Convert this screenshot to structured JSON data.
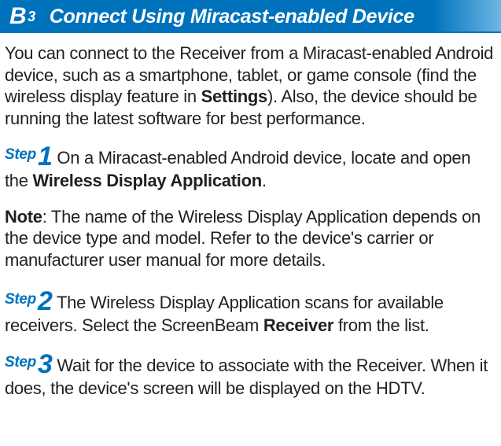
{
  "header": {
    "badge_letter": "B",
    "badge_super": "3",
    "title": "Connect Using Miracast-enabled Device"
  },
  "intro": {
    "pre": "You can connect to the Receiver from a Miracast-enabled Android device, such as a smartphone, tablet, or game console (find the wireless display feature in ",
    "bold": "Settings",
    "post": "). Also, the device should be running the latest software for best performance."
  },
  "steps": [
    {
      "label_word": "Step",
      "label_num": "1",
      "pre": " On a Miracast-enabled Android device, locate and open the ",
      "bold": "Wireless Display Application",
      "post": "."
    },
    {
      "label_word": "Step",
      "label_num": "2",
      "pre": " The Wireless Display Application scans for available receivers. Select the ScreenBeam ",
      "bold": "Receiver",
      "post": " from the list."
    },
    {
      "label_word": "Step",
      "label_num": "3",
      "pre": " Wait for the device to associate with the Receiver. When it does, the device's screen will be displayed on the HDTV.",
      "bold": "",
      "post": ""
    }
  ],
  "note": {
    "label": "Note",
    "text": ": The name of the Wireless Display Application depends on the device type and model. Refer to the device's carrier or manufacturer user manual for more details."
  }
}
